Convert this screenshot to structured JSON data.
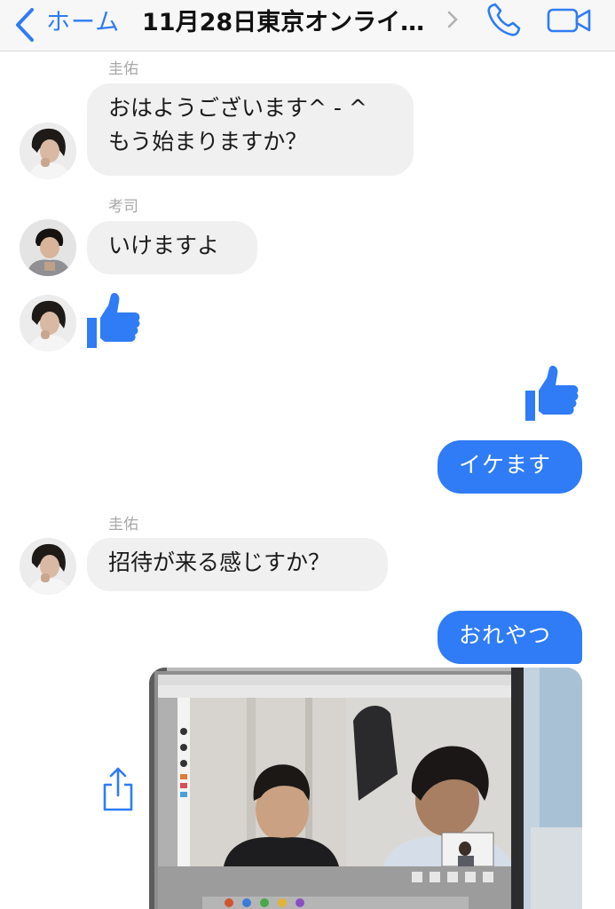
{
  "header": {
    "back_label": "ホーム",
    "title": "11月28日東京オンライ…",
    "icons": [
      "chevron-left-icon",
      "chevron-right-icon",
      "phone-icon",
      "video-icon"
    ]
  },
  "messages": [
    {
      "sender": "圭佑",
      "lines": [
        "おはようございます^ - ^",
        "もう始まりますか？"
      ]
    },
    {
      "sender": "考司",
      "lines": [
        "いけますよ"
      ]
    },
    {
      "type": "like",
      "from": "incoming"
    },
    {
      "type": "like",
      "from": "outgoing"
    },
    {
      "from": "outgoing",
      "text": "イケます"
    },
    {
      "sender": "圭佑",
      "lines": [
        "招待が来る感じすか？"
      ]
    },
    {
      "from": "outgoing",
      "text": "おれやつ"
    },
    {
      "from": "outgoing",
      "type": "photo",
      "content": "video-call-screenshot"
    }
  ],
  "colors": {
    "accent": "#2e7cf6",
    "incoming_bubble": "#f0f0f0",
    "outgoing_bubble": "#2f7cf6"
  }
}
